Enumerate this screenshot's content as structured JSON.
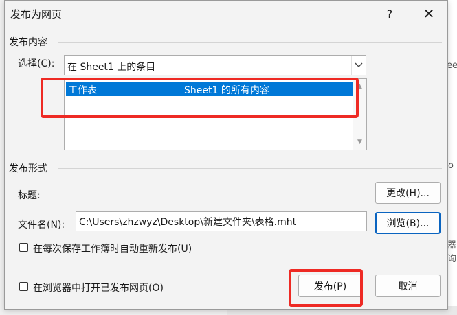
{
  "dialog": {
    "title": "发布为网页",
    "help_label": "?",
    "close_label": "✕"
  },
  "publish_content": {
    "section_label": "发布内容",
    "choose_label": "选择(C):",
    "selected_value": "在 Sheet1 上的条目",
    "list_items": [
      {
        "type": "工作表",
        "description": "Sheet1 的所有内容"
      }
    ]
  },
  "publish_format": {
    "section_label": "发布形式",
    "title_label": "标题:",
    "change_button": "更改(H)...",
    "filename_label": "文件名(N):",
    "filename_value": "C:\\Users\\zhzwyz\\Desktop\\新建文件夹\\表格.mht",
    "browse_button": "浏览(B)...",
    "auto_republish_label": "在每次保存工作簿时自动重新发布(U)",
    "auto_republish_checked": false
  },
  "footer": {
    "open_in_browser_label": "在浏览器中打开已发布网页(O)",
    "open_in_browser_checked": false,
    "publish_button": "发布(P)",
    "cancel_button": "取消"
  },
  "background": {
    "edge_texts": [
      "ee",
      "o",
      "器",
      "询"
    ]
  },
  "colors": {
    "selection": "#0078d7",
    "highlight": "#ee2a24",
    "default_button_border": "#0a64c0"
  }
}
